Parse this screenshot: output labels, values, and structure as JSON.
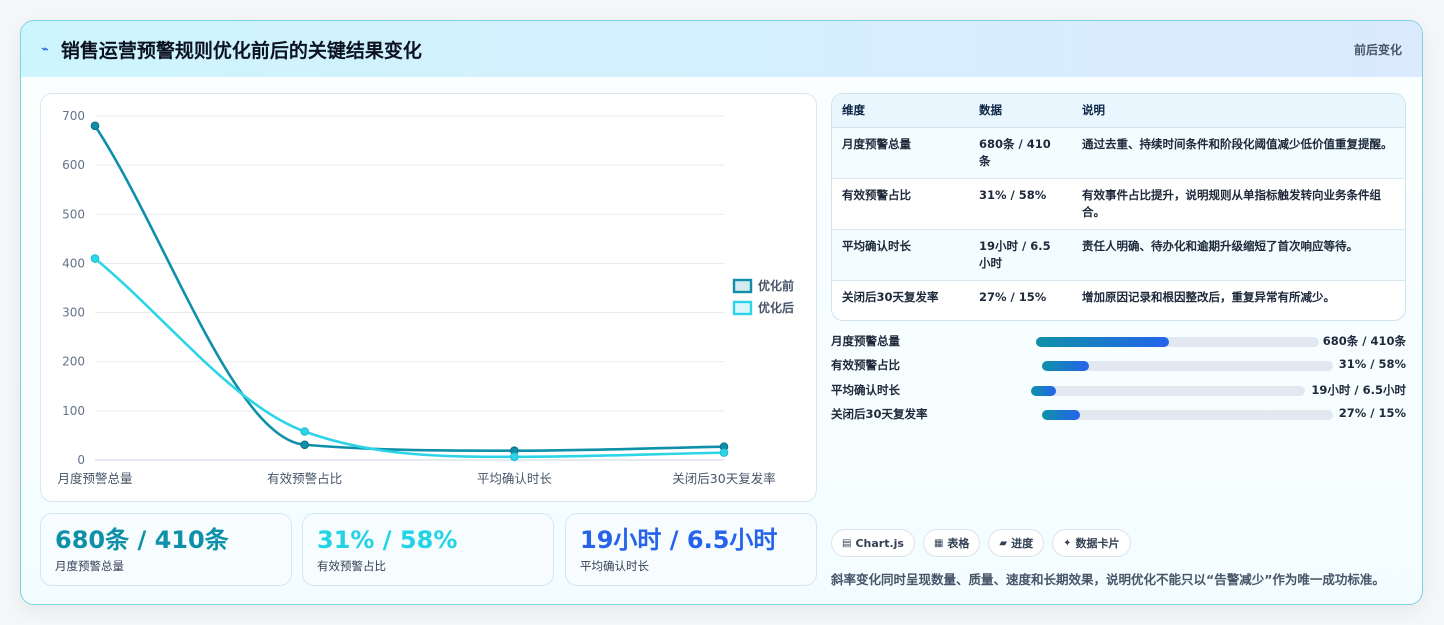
{
  "header": {
    "title": "销售运营预警规则优化前后的关键结果变化",
    "tag": "前后变化"
  },
  "chart_data": {
    "type": "line",
    "categories": [
      "月度预警总量",
      "有效预警占比",
      "平均确认时长",
      "关闭后30天复发率"
    ],
    "series": [
      {
        "name": "优化前",
        "values": [
          680,
          31,
          19,
          27
        ],
        "color": "#0e91a8"
      },
      {
        "name": "优化后",
        "values": [
          410,
          58,
          6.5,
          15
        ],
        "color": "#2dd4e8"
      }
    ],
    "ylim": [
      0,
      700
    ],
    "yticks": [
      0,
      100,
      200,
      300,
      400,
      500,
      600,
      700
    ],
    "grid": true,
    "legend": "right"
  },
  "kpis": [
    {
      "value": "680条 / 410条",
      "label": "月度预警总量",
      "color": "#0e91a8"
    },
    {
      "value": "31% / 58%",
      "label": "有效预警占比",
      "color": "#22d3e6"
    },
    {
      "value": "19小时 / 6.5小时",
      "label": "平均确认时长",
      "color": "#2563eb"
    }
  ],
  "table": {
    "headers": [
      "维度",
      "数据",
      "说明"
    ],
    "rows": [
      [
        "月度预警总量",
        "680条 / 410条",
        "通过去重、持续时间条件和阶段化阈值减少低价值重复提醒。"
      ],
      [
        "有效预警占比",
        "31% / 58%",
        "有效事件占比提升，说明规则从单指标触发转向业务条件组合。"
      ],
      [
        "平均确认时长",
        "19小时 / 6.5小时",
        "责任人明确、待办化和逾期升级缩短了首次响应等待。"
      ],
      [
        "关闭后30天复发率",
        "27% / 15%",
        "增加原因记录和根因整改后，重复异常有所减少。"
      ]
    ]
  },
  "progress": [
    {
      "label": "月度预警总量",
      "value": "680条 / 410条",
      "fill": 0.47
    },
    {
      "label": "有效预警占比",
      "value": "31% / 58%",
      "fill": 0.16
    },
    {
      "label": "平均确认时长",
      "value": "19小时 / 6.5小时",
      "fill": 0.09
    },
    {
      "label": "关闭后30天复发率",
      "value": "27% / 15%",
      "fill": 0.13
    }
  ],
  "chips": [
    {
      "icon": "▤",
      "label": "Chart.js"
    },
    {
      "icon": "▦",
      "label": "表格"
    },
    {
      "icon": "▰",
      "label": "进度"
    },
    {
      "icon": "✦",
      "label": "数据卡片"
    }
  ],
  "note": "斜率变化同时呈现数量、质量、速度和长期效果，说明优化不能只以“告警减少”作为唯一成功标准。"
}
